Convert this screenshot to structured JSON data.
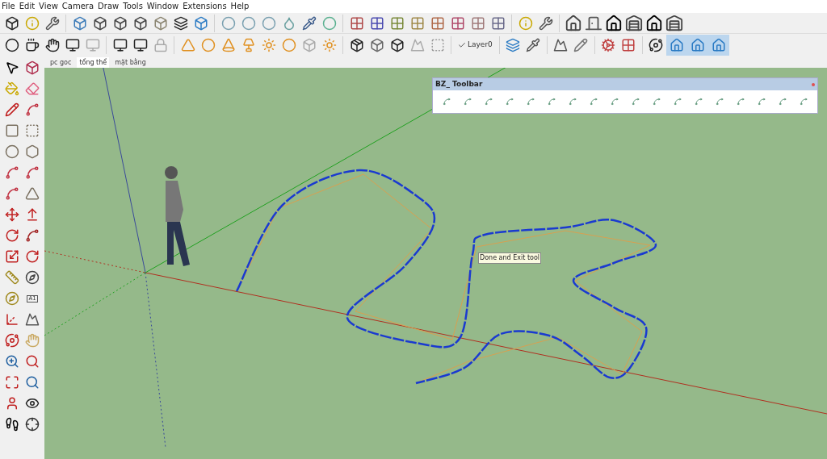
{
  "menu": [
    "File",
    "Edit",
    "View",
    "Camera",
    "Draw",
    "Tools",
    "Window",
    "Extensions",
    "Help"
  ],
  "layer": {
    "label": "Layer0",
    "visible": true
  },
  "scene_tabs": [
    {
      "label": "pc goc",
      "selected": false
    },
    {
      "label": "tổng thể",
      "selected": true
    },
    {
      "label": "mặt bằng",
      "selected": false
    }
  ],
  "text_tool_label": "A1",
  "bz_toolbar": {
    "title": "BZ_ Toolbar"
  },
  "tooltip": "Done and Exit tool"
}
